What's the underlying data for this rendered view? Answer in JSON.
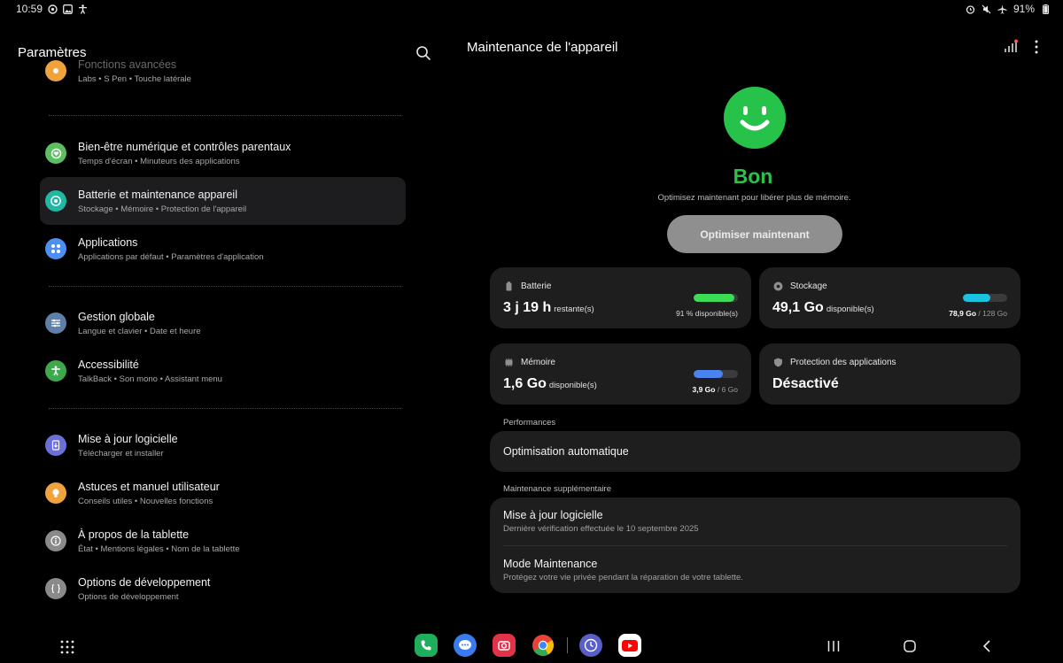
{
  "status_bar": {
    "time": "10:59",
    "battery": "91%",
    "left_icons": [
      "notification-icon",
      "image-icon",
      "accessibility-icon"
    ],
    "right_icons": [
      "alarm-icon",
      "mute-icon",
      "airplane-icon"
    ]
  },
  "left_panel": {
    "title": "Paramètres",
    "items": [
      {
        "title": "Fonctions avancées",
        "sub": "Labs  •  S Pen  •  Touche latérale",
        "color": "#f0a33c"
      },
      {
        "title": "Bien-être numérique et contrôles parentaux",
        "sub": "Temps d'écran  •  Minuteurs des applications",
        "color": "#5bbf62"
      },
      {
        "title": "Batterie et maintenance appareil",
        "sub": "Stockage  •  Mémoire  •  Protection de l'appareil",
        "color": "#22b7a4"
      },
      {
        "title": "Applications",
        "sub": "Applications par défaut  •  Paramètres d'application",
        "color": "#4f8ff2"
      },
      {
        "title": "Gestion globale",
        "sub": "Langue et clavier  •  Date et heure",
        "color": "#5f7fa6"
      },
      {
        "title": "Accessibilité",
        "sub": "TalkBack  •  Son mono  •  Assistant menu",
        "color": "#3ea84c"
      },
      {
        "title": "Mise à jour logicielle",
        "sub": "Télécharger et installer",
        "color": "#6b6fd8"
      },
      {
        "title": "Astuces et manuel utilisateur",
        "sub": "Conseils utiles  •  Nouvelles fonctions",
        "color": "#f0a33c"
      },
      {
        "title": "À propos de la tablette",
        "sub": "État  •  Mentions légales  •  Nom de la tablette",
        "color": "#8a8a8a"
      },
      {
        "title": "Options de développement",
        "sub": "Options de développement",
        "color": "#8a8a8a"
      }
    ]
  },
  "right_panel": {
    "title": "Maintenance de l'appareil",
    "status_word": "Bon",
    "status_desc": "Optimisez maintenant pour libérer plus de mémoire.",
    "optimize_label": "Optimiser maintenant",
    "cards": {
      "battery": {
        "label": "Batterie",
        "value": "3 j 19 h",
        "unit": "restante(s)",
        "meta": "91 % disponible(s)",
        "fill": 0.91,
        "color": "#3ddc57"
      },
      "storage": {
        "label": "Stockage",
        "value": "49,1 Go",
        "unit": "disponible(s)",
        "meta_used": "78,9 Go",
        "meta_total": "/ 128 Go",
        "fill": 0.62,
        "color": "#19c2df"
      },
      "memory": {
        "label": "Mémoire",
        "value": "1,6 Go",
        "unit": "disponible(s)",
        "meta_used": "3,9 Go",
        "meta_total": "/ 6 Go",
        "fill": 0.65,
        "color": "#4a82f0"
      },
      "protection": {
        "label": "Protection des applications",
        "value": "Désactivé"
      }
    },
    "performances_label": "Performances",
    "auto_optimization": "Optimisation automatique",
    "extra_label": "Maintenance supplémentaire",
    "software_update": {
      "title": "Mise à jour logicielle",
      "sub": "Dernière vérification effectuée le 10 septembre 2025"
    },
    "maintenance_mode": {
      "title": "Mode Maintenance",
      "sub": "Protégez votre vie privée pendant la réparation de votre tablette."
    }
  },
  "dock": {
    "apps": [
      {
        "name": "phone-app-icon",
        "color": "#1fae5b"
      },
      {
        "name": "messages-app-icon",
        "color": "#3a7cf0"
      },
      {
        "name": "camera-app-icon",
        "color": "#e0334a"
      },
      {
        "name": "chrome-app-icon",
        "color": "#ffffff"
      },
      {
        "name": "clock-app-icon",
        "color": "#5a5fc8"
      },
      {
        "name": "youtube-app-icon",
        "color": "#ff0000"
      }
    ]
  }
}
